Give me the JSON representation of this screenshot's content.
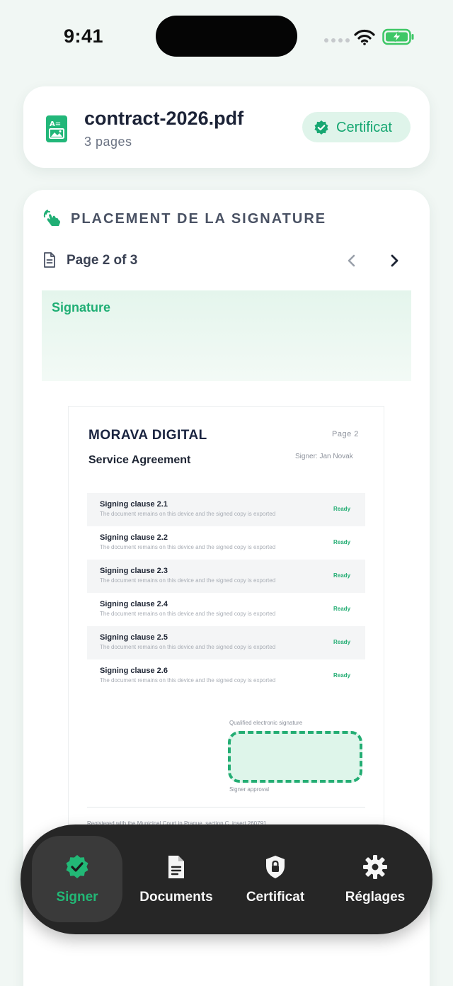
{
  "status_bar": {
    "time": "9:41"
  },
  "file": {
    "name": "contract-2026.pdf",
    "pages": "3 pages",
    "badge": "Certificat"
  },
  "placement": {
    "title": "PLACEMENT DE LA SIGNATURE",
    "page_label": "Page 2 of 3",
    "signature_strip_label": "Signature"
  },
  "document": {
    "company": "MORAVA DIGITAL",
    "page": "Page  2",
    "title": "Service Agreement",
    "signer": "Signer: Jan Novak",
    "clauses": [
      {
        "title": "Signing clause 2.1",
        "desc": "The document remains on this device and the signed copy is exported",
        "status": "Ready"
      },
      {
        "title": "Signing clause 2.2",
        "desc": "The document remains on this device and the signed copy is exported",
        "status": "Ready"
      },
      {
        "title": "Signing clause 2.3",
        "desc": "The document remains on this device and the signed copy is exported",
        "status": "Ready"
      },
      {
        "title": "Signing clause 2.4",
        "desc": "The document remains on this device and the signed copy is exported",
        "status": "Ready"
      },
      {
        "title": "Signing clause 2.5",
        "desc": "The document remains on this device and the signed copy is exported",
        "status": "Ready"
      },
      {
        "title": "Signing clause 2.6",
        "desc": "The document remains on this device and the signed copy is exported",
        "status": "Ready"
      }
    ],
    "signature_caption": "Qualified electronic signature",
    "signature_approval": "Signer approval",
    "footer": "Registered with the Municipal Court in Prague, section C, insert 260791"
  },
  "tabs": [
    {
      "label": "Signer",
      "icon": "verified-badge-icon",
      "active": true
    },
    {
      "label": "Documents",
      "icon": "document-icon",
      "active": false
    },
    {
      "label": "Certificat",
      "icon": "shield-lock-icon",
      "active": false
    },
    {
      "label": "Réglages",
      "icon": "gear-icon",
      "active": false
    }
  ],
  "colors": {
    "accent": "#1fae74",
    "background": "#f1f7f4",
    "tab_bar": "#262626"
  }
}
